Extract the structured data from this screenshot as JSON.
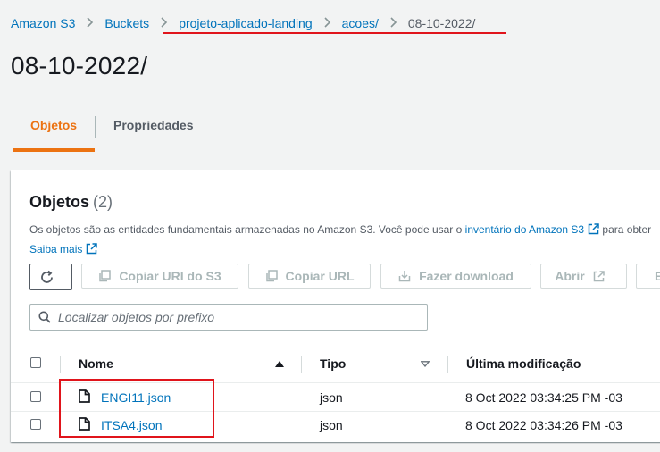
{
  "breadcrumb": {
    "items": [
      "Amazon S3",
      "Buckets",
      "projeto-aplicado-landing",
      "acoes/",
      "08-10-2022/"
    ],
    "separator": ">"
  },
  "page": {
    "title": "08-10-2022/"
  },
  "tabs": [
    {
      "label": "Objetos",
      "active": true
    },
    {
      "label": "Propriedades",
      "active": false
    }
  ],
  "objects_panel": {
    "title": "Objetos",
    "count": "(2)",
    "description_start": "Os objetos são as entidades fundamentais armazenadas no Amazon S3. Você pode usar o ",
    "inventory_link": "inventário do Amazon S3",
    "description_cont": " para obter",
    "more_link": "Saiba mais",
    "toolbar": {
      "refresh_icon": "refresh-icon",
      "copy_uri": "Copiar URI do S3",
      "copy_url": "Copiar URL",
      "download": "Fazer download",
      "open": "Abrir",
      "partial": "E"
    },
    "search": {
      "placeholder": "Localizar objetos por prefixo"
    },
    "table": {
      "columns": [
        "Nome",
        "Tipo",
        "Última modificação"
      ],
      "rows": [
        {
          "name": "ENGI11.json",
          "type": "json",
          "modified": "8 Oct 2022 03:34:25 PM -03"
        },
        {
          "name": "ITSA4.json",
          "type": "json",
          "modified": "8 Oct 2022 03:34:26 PM -03"
        }
      ]
    }
  },
  "colors": {
    "link": "#0073bb",
    "accent": "#ec7211",
    "annotation": "#e0141b",
    "disabled": "#aab7b8"
  }
}
